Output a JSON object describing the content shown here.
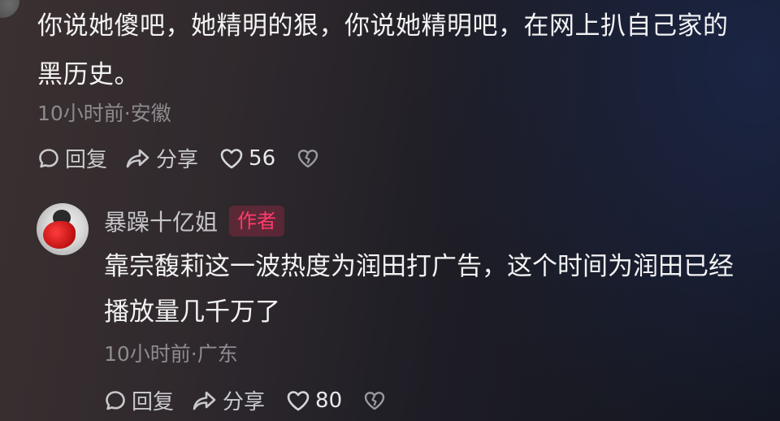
{
  "comment": {
    "text_line1": "你说她傻吧，她精明的狠，你说她精明吧，在网上扒自己家的",
    "text_line2": "黑历史。",
    "time_location": "10小时前·安徽",
    "reply_label": "回复",
    "share_label": "分享",
    "like_count": "56"
  },
  "reply": {
    "username": "暴躁十亿姐",
    "badge": "作者",
    "text_line1": "靠宗馥莉这一波热度为润田打广告，这个时间为润田已经",
    "text_line2": "播放量几千万了",
    "time_location": "10小时前·广东",
    "reply_label": "回复",
    "share_label": "分享",
    "like_count": "80"
  },
  "colors": {
    "badge_text": "#ff3b6b",
    "meta_text": "#8d8b8f",
    "action_text": "#c9c9cd"
  },
  "icons": [
    "comment-bubble-icon",
    "share-arrow-icon",
    "heart-icon",
    "dislike-broken-heart-icon"
  ]
}
